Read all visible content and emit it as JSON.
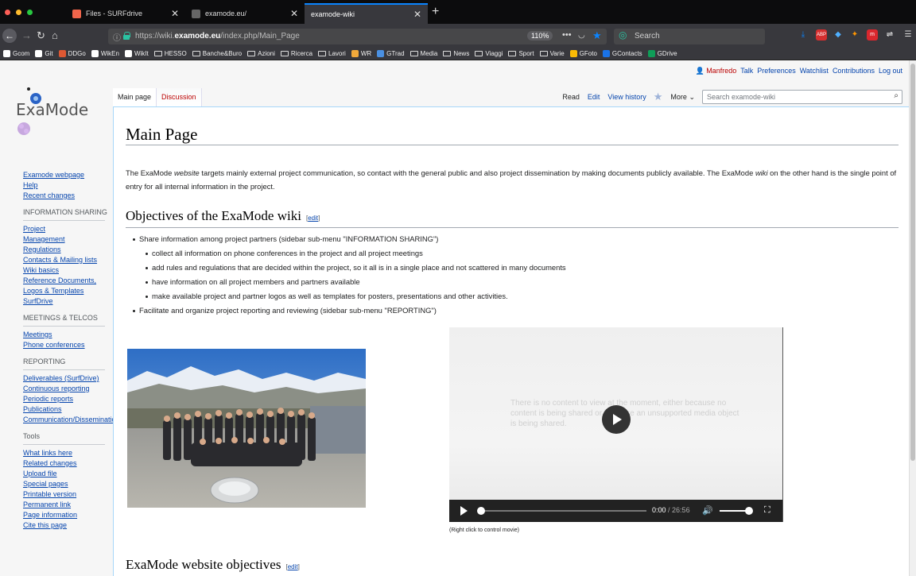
{
  "browser": {
    "tabs": [
      {
        "label": "Files - SURFdrive",
        "active": false
      },
      {
        "label": "examode.eu/",
        "active": false
      },
      {
        "label": "examode-wiki",
        "active": true
      }
    ],
    "url_prefix": "https://wiki.",
    "url_domain": "examode.eu",
    "url_path": "/index.php/Main_Page",
    "zoom": "110%",
    "search_placeholder": "Search",
    "bookmarks": [
      {
        "label": "Gcom",
        "icon": "google-icon",
        "color": "#ffffff"
      },
      {
        "label": "Git",
        "icon": "google-icon",
        "color": "#ffffff"
      },
      {
        "label": "DDGo",
        "icon": "duckduckgo-icon",
        "color": "#de5833"
      },
      {
        "label": "WikEn",
        "icon": "wikipedia-icon",
        "color": "#ffffff"
      },
      {
        "label": "WikIt",
        "icon": "wikipedia-icon",
        "color": "#ffffff"
      },
      {
        "label": "HESSO",
        "icon": "folder-icon",
        "color": ""
      },
      {
        "label": "Banche&Buro",
        "icon": "folder-icon",
        "color": ""
      },
      {
        "label": "Azioni",
        "icon": "folder-icon",
        "color": ""
      },
      {
        "label": "Ricerca",
        "icon": "folder-icon",
        "color": ""
      },
      {
        "label": "Lavori",
        "icon": "folder-icon",
        "color": ""
      },
      {
        "label": "WR",
        "icon": "wordreference-icon",
        "color": "#f1a93b"
      },
      {
        "label": "GTrad",
        "icon": "translate-icon",
        "color": "#4a90e2"
      },
      {
        "label": "Media",
        "icon": "folder-icon",
        "color": ""
      },
      {
        "label": "News",
        "icon": "folder-icon",
        "color": ""
      },
      {
        "label": "Viaggi",
        "icon": "folder-icon",
        "color": ""
      },
      {
        "label": "Sport",
        "icon": "folder-icon",
        "color": ""
      },
      {
        "label": "Varie",
        "icon": "folder-icon",
        "color": ""
      },
      {
        "label": "GFoto",
        "icon": "photos-icon",
        "color": "#fbbc05"
      },
      {
        "label": "GContacts",
        "icon": "contacts-icon",
        "color": "#1a73e8"
      },
      {
        "label": "GDrive",
        "icon": "drive-icon",
        "color": "#0f9d58"
      }
    ]
  },
  "personal": {
    "user": "Manfredo",
    "links": [
      "Talk",
      "Preferences",
      "Watchlist",
      "Contributions",
      "Log out"
    ]
  },
  "logo": {
    "text": "ExaMode"
  },
  "tabs": {
    "left": [
      "Main page",
      "Discussion"
    ],
    "right": [
      "Read",
      "Edit",
      "View history"
    ],
    "more": "More",
    "search_placeholder": "Search examode-wiki"
  },
  "sidebar": {
    "top": [
      "Examode webpage",
      "Help",
      "Recent changes"
    ],
    "sections": [
      {
        "heading": "INFORMATION SHARING",
        "items": [
          "Project",
          "Management",
          "Regulations",
          "Contacts & Mailing lists",
          "Wiki basics",
          "Reference Documents, Logos & Templates",
          "SurfDrive"
        ]
      },
      {
        "heading": "MEETINGS & TELCOS",
        "items": [
          "Meetings",
          "Phone conferences"
        ]
      },
      {
        "heading": "REPORTING",
        "items": [
          "Deliverables (SurfDrive)",
          "Continuous reporting",
          "Periodic reports",
          "Publications",
          "Communication/Dissemination"
        ]
      },
      {
        "heading": "Tools",
        "items": [
          "What links here",
          "Related changes",
          "Upload file",
          "Special pages",
          "Printable version",
          "Permanent link",
          "Page information",
          "Cite this page"
        ]
      }
    ]
  },
  "content": {
    "title": "Main Page",
    "intro_1": "The ExaMode ",
    "intro_website": "website",
    "intro_2": " targets mainly external project communication, so contact with the general public and also project dissemination by making documents publicly available. The ExaMode ",
    "intro_wiki": "wiki",
    "intro_3": " on the other hand is the single point of entry for all internal information in the project.",
    "section1_title": "Objectives of the ExaMode wiki",
    "edit_label": "edit",
    "bullets": [
      {
        "text": "Share information among project partners (sidebar sub-menu \"INFORMATION SHARING\")",
        "level": 1
      },
      {
        "text": "collect all information on phone conferences in the project and all project meetings",
        "level": 2
      },
      {
        "text": "add rules and regulations that are decided within the project, so it all is in a single place and not scattered in many documents",
        "level": 2
      },
      {
        "text": "have information on all project members and partners available",
        "level": 2
      },
      {
        "text": "make available project and partner logos as well as templates for posters, presentations and other activities.",
        "level": 2
      },
      {
        "text": "Facilitate and organize project reporting and reviewing (sidebar sub-menu \"REPORTING\")",
        "level": 1
      }
    ],
    "video_message": "There is no content to view at the moment, either because no content is being shared or because an unsupported media object is being shared.",
    "video_time_current": "0:00",
    "video_time_total": "26:56",
    "video_caption": "(Right click to control movie)",
    "section2_title": "ExaMode website objectives"
  }
}
